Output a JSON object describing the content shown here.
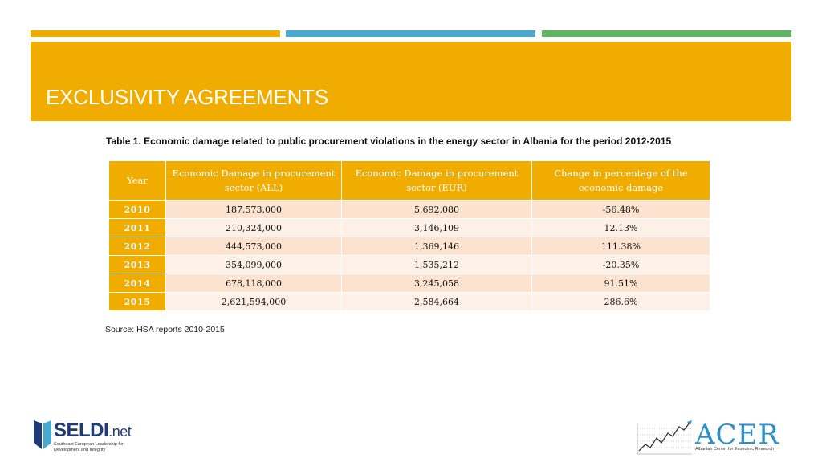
{
  "slide": {
    "title": "EXCLUSIVITY AGREEMENTS",
    "caption": "Table 1. Economic damage related to public procurement violations in the energy sector in Albania for the period 2012-2015",
    "source": "Source: HSA reports 2010-2015"
  },
  "colors": {
    "accent_orange": "#f0ad00",
    "accent_blue": "#4aa9cf",
    "accent_green": "#5fb562",
    "row_light": "#fbe3cf",
    "row_lighter": "#fdf1e7"
  },
  "table": {
    "headers": [
      "Year",
      "Economic Damage in procurement sector (ALL)",
      "Economic Damage in procurement sector (EUR)",
      "Change in percentage of the economic damage"
    ],
    "rows": [
      [
        "2010",
        "187,573,000",
        "5,692,080",
        "-56.48%"
      ],
      [
        "2011",
        "210,324,000",
        "3,146,109",
        "12.13%"
      ],
      [
        "2012",
        "444,573,000",
        "1,369,146",
        "111.38%"
      ],
      [
        "2013",
        "354,099,000",
        "1,535,212",
        "-20.35%"
      ],
      [
        "2014",
        "678,118,000",
        "3,245,058",
        "91.51%"
      ],
      [
        "2015",
        "2,621,594,000",
        "2,584,664",
        "286.6%"
      ]
    ]
  },
  "logos": {
    "seldi_name": "SELDI",
    "seldi_suffix": ".net",
    "seldi_tagline": "Southeast European Leadership for Development and Integrity",
    "acer_name": "ACER",
    "acer_tagline": "Albanian Center for Economic Research"
  }
}
